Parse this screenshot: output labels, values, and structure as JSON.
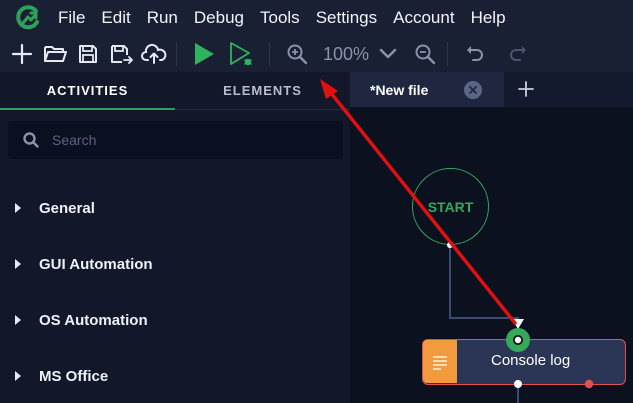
{
  "menu": [
    "File",
    "Edit",
    "Run",
    "Debug",
    "Tools",
    "Settings",
    "Account",
    "Help"
  ],
  "toolbar": {
    "zoom": "100%"
  },
  "panel": {
    "tabs": [
      "ACTIVITIES",
      "ELEMENTS"
    ],
    "search_placeholder": "Search",
    "categories": [
      "General",
      "GUI Automation",
      "OS Automation",
      "MS Office"
    ]
  },
  "editor": {
    "tab_title": "*New file",
    "start_label": "START",
    "node_label": "Console log"
  },
  "colors": {
    "accent_green": "#2fa05a",
    "annotation_red": "#e01010",
    "node_orange": "#f29a3d"
  },
  "icons": [
    "app-logo-icon",
    "new-icon",
    "open-folder-icon",
    "save-icon",
    "save-as-icon",
    "cloud-upload-icon",
    "run-icon",
    "debug-run-icon",
    "zoom-in-icon",
    "chevron-down-icon",
    "zoom-out-icon",
    "undo-icon",
    "redo-icon",
    "search-icon",
    "close-icon",
    "add-tab-icon",
    "log-icon"
  ]
}
